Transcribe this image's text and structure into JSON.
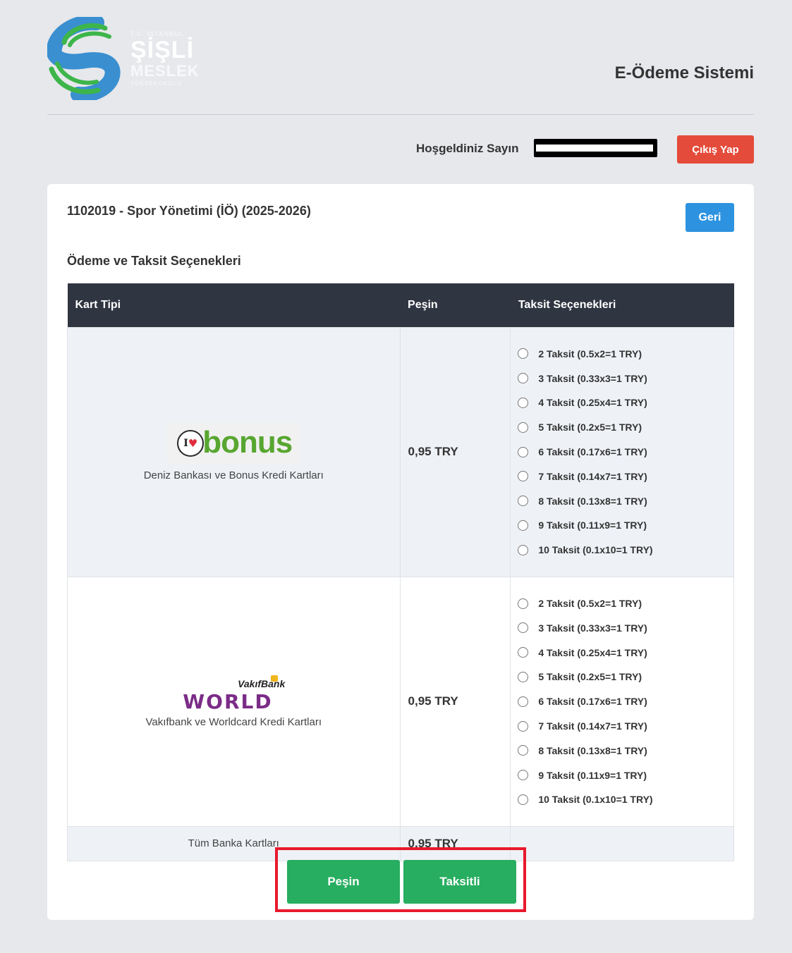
{
  "header": {
    "logo": {
      "line1": "T.C. İSTANBUL",
      "line2": "ŞİŞLİ",
      "line3": "MESLEK",
      "line4": "YÜKSEKOKULU"
    },
    "app_title": "E-Ödeme Sistemi"
  },
  "welcome": {
    "text": "Hoşgeldiniz Sayın",
    "logout_label": "Çıkış Yap"
  },
  "card": {
    "program_title": "1102019 - Spor Yönetimi (İÖ) (2025-2026)",
    "back_label": "Geri",
    "section_title": "Ödeme ve Taksit Seçenekleri",
    "table": {
      "headers": [
        "Kart Tipi",
        "Peşin",
        "Taksit Seçenekleri"
      ],
      "rows": [
        {
          "logo_name": "bonus-logo",
          "card_label": "Deniz Bankası ve Bonus Kredi Kartları",
          "cash": "0,95 TRY",
          "installments": [
            "2 Taksit (0.5x2=1 TRY)",
            "3 Taksit (0.33x3=1 TRY)",
            "4 Taksit (0.25x4=1 TRY)",
            "5 Taksit (0.2x5=1 TRY)",
            "6 Taksit (0.17x6=1 TRY)",
            "7 Taksit (0.14x7=1 TRY)",
            "8 Taksit (0.13x8=1 TRY)",
            "9 Taksit (0.11x9=1 TRY)",
            "10 Taksit (0.1x10=1 TRY)"
          ]
        },
        {
          "logo_name": "worldcard-logo",
          "card_label": "Vakıfbank ve Worldcard Kredi Kartları",
          "cash": "0,95 TRY",
          "installments": [
            "2 Taksit (0.5x2=1 TRY)",
            "3 Taksit (0.33x3=1 TRY)",
            "4 Taksit (0.25x4=1 TRY)",
            "5 Taksit (0.2x5=1 TRY)",
            "6 Taksit (0.17x6=1 TRY)",
            "7 Taksit (0.14x7=1 TRY)",
            "8 Taksit (0.13x8=1 TRY)",
            "9 Taksit (0.11x9=1 TRY)",
            "10 Taksit (0.1x10=1 TRY)"
          ]
        },
        {
          "card_label": "Tüm Banka Kartları",
          "cash": "0,95 TRY",
          "installments": []
        }
      ]
    },
    "logos": {
      "bonus_word": "bonus",
      "bonus_badge": "I",
      "vakifbank_text": "VakıfBank",
      "world_text": "WORLD"
    },
    "actions": {
      "cash_label": "Peşin",
      "installment_label": "Taksitli"
    }
  },
  "colors": {
    "background": "#e6e8ec",
    "table_header": "#2f3541",
    "logout": "#e44b3a",
    "back": "#2d93e0",
    "action": "#27ae60",
    "highlight_box": "#e8192c"
  }
}
